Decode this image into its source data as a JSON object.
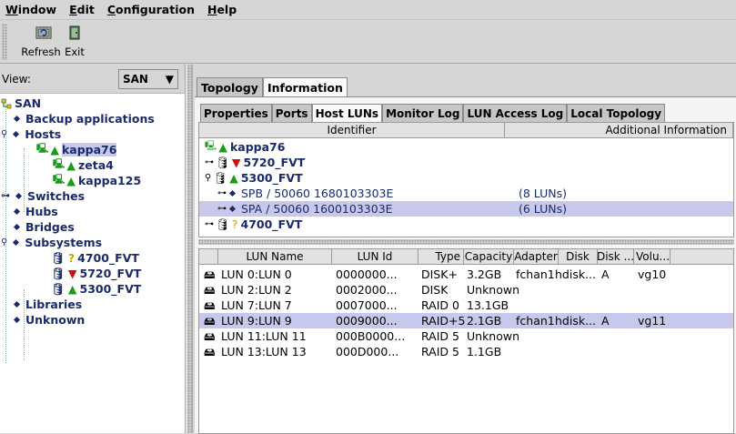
{
  "menu": [
    {
      "label": "Window",
      "mnemonic": "W",
      "rest": "indow"
    },
    {
      "label": "Edit",
      "mnemonic": "E",
      "rest": "dit"
    },
    {
      "label": "Configuration",
      "mnemonic": "C",
      "rest": "onfiguration"
    },
    {
      "label": "Help",
      "mnemonic": "H",
      "rest": "elp"
    }
  ],
  "toolbar": {
    "refresh_label": "Refresh",
    "exit_label": "Exit"
  },
  "left": {
    "view_label": "View:",
    "view_value": "SAN",
    "tree": {
      "root": "SAN",
      "backup": "Backup applications",
      "hosts": "Hosts",
      "host_items": [
        "kappa76",
        "zeta4",
        "kappa125"
      ],
      "switches": "Switches",
      "hubs": "Hubs",
      "bridges": "Bridges",
      "subsystems": "Subsystems",
      "subsystem_items": [
        "4700_FVT",
        "5720_FVT",
        "5300_FVT"
      ],
      "libraries": "Libraries",
      "unknown": "Unknown"
    }
  },
  "tabs_main": [
    "Topology",
    "Information"
  ],
  "tabs_sub": [
    "Properties",
    "Ports",
    "Host LUNs",
    "Monitor Log",
    "LUN Access Log",
    "Local Topology"
  ],
  "upper": {
    "headers": [
      "Identifier",
      "Additional Information"
    ],
    "host": "kappa76",
    "sub1": "5720_FVT",
    "sub2": "5300_FVT",
    "spb": "SPB / 50060 1680103303E",
    "spb_info": "(8 LUNs)",
    "spa": "SPA / 50060 1600103303E",
    "spa_info": "(6 LUNs)",
    "sub3": "4700_FVT"
  },
  "lower": {
    "headers": [
      "LUN Name",
      "LUN Id",
      "Type",
      "Capacity",
      "Adapter",
      "Disk",
      "Disk ...",
      "Volu..."
    ],
    "rows": [
      {
        "name": "LUN 0:LUN 0",
        "id": "0000000...",
        "type": "DISK+",
        "cap": "3.2GB",
        "adapter": "fchan1",
        "disk": "hdisk...",
        "disk2": "A",
        "vol": "vg10"
      },
      {
        "name": "LUN 2:LUN 2",
        "id": "0002000...",
        "type": "DISK",
        "cap": "Unknown",
        "adapter": "",
        "disk": "",
        "disk2": "",
        "vol": ""
      },
      {
        "name": "LUN 7:LUN 7",
        "id": "0007000...",
        "type": "RAID 0",
        "cap": "13.1GB",
        "adapter": "",
        "disk": "",
        "disk2": "",
        "vol": ""
      },
      {
        "name": "LUN 9:LUN 9",
        "id": "0009000...",
        "type": "RAID+5",
        "cap": "2.1GB",
        "adapter": "fchan1",
        "disk": "hdisk...",
        "disk2": "A",
        "vol": "vg11"
      },
      {
        "name": "LUN 11:LUN 11",
        "id": "000B0000...",
        "type": "RAID 5",
        "cap": "Unknown",
        "adapter": "",
        "disk": "",
        "disk2": "",
        "vol": ""
      },
      {
        "name": "LUN 13:LUN 13",
        "id": "000D000...",
        "type": "RAID 5",
        "cap": "1.1GB",
        "adapter": "",
        "disk": "",
        "disk2": "",
        "vol": ""
      }
    ]
  }
}
